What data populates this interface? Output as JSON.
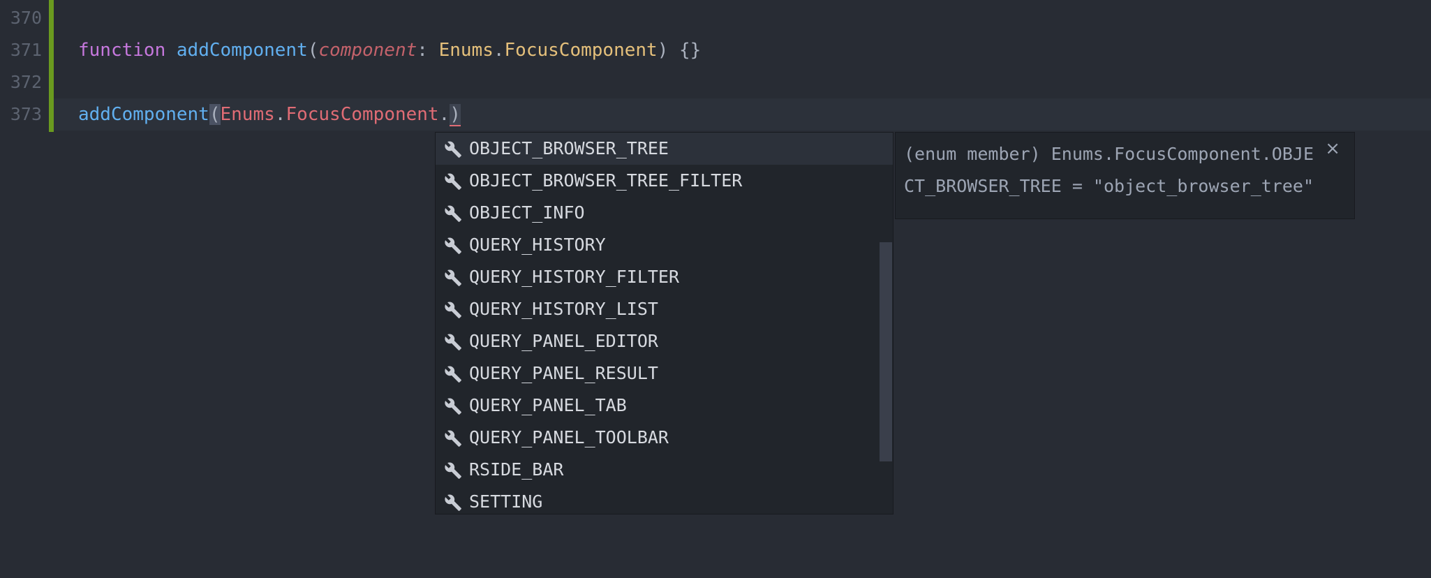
{
  "gutter": {
    "line_numbers": [
      "370",
      "371",
      "372",
      "373"
    ]
  },
  "code": {
    "line371": {
      "keyword": "function",
      "fn_name": "addComponent",
      "open_paren": "(",
      "param": "component",
      "colon": ": ",
      "type_ns": "Enums",
      "dot": ".",
      "type_name": "FocusComponent",
      "rest": ") {}"
    },
    "line373": {
      "fn_name": "addComponent",
      "open_paren": "(",
      "enum_ns": "Enums",
      "dot1": ".",
      "enum_name": "FocusComponent",
      "dot2": ".",
      "close_paren": ")"
    }
  },
  "suggest": {
    "items": [
      {
        "label": "OBJECT_BROWSER_TREE",
        "icon": "wrench-icon"
      },
      {
        "label": "OBJECT_BROWSER_TREE_FILTER",
        "icon": "wrench-icon"
      },
      {
        "label": "OBJECT_INFO",
        "icon": "wrench-icon"
      },
      {
        "label": "QUERY_HISTORY",
        "icon": "wrench-icon"
      },
      {
        "label": "QUERY_HISTORY_FILTER",
        "icon": "wrench-icon"
      },
      {
        "label": "QUERY_HISTORY_LIST",
        "icon": "wrench-icon"
      },
      {
        "label": "QUERY_PANEL_EDITOR",
        "icon": "wrench-icon"
      },
      {
        "label": "QUERY_PANEL_RESULT",
        "icon": "wrench-icon"
      },
      {
        "label": "QUERY_PANEL_TAB",
        "icon": "wrench-icon"
      },
      {
        "label": "QUERY_PANEL_TOOLBAR",
        "icon": "wrench-icon"
      },
      {
        "label": "RSIDE_BAR",
        "icon": "wrench-icon"
      },
      {
        "label": "SETTING",
        "icon": "wrench-icon"
      }
    ],
    "selected_index": 0
  },
  "details": {
    "text": "(enum member) Enums.FocusComponent.OBJECT_BROWSER_TREE = \"object_browser_tree\"",
    "close_label": "×"
  },
  "colors": {
    "background": "#282c34",
    "keyword": "#c678dd",
    "function": "#61afef",
    "type": "#e5c07b",
    "enum": "#e06c75",
    "modified_bar": "#6a9a1f"
  }
}
